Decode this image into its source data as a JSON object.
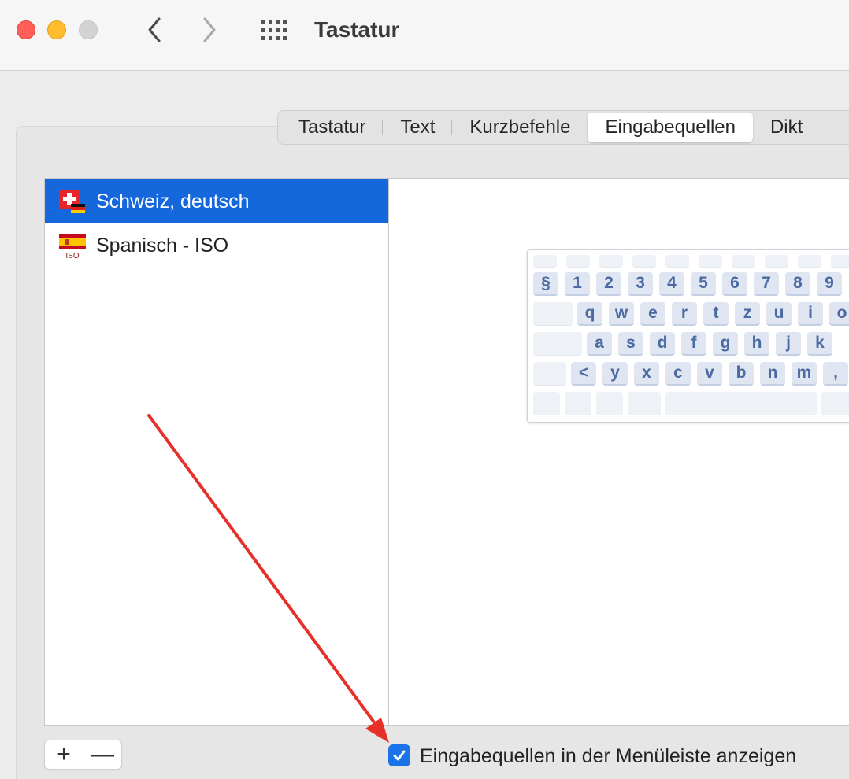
{
  "window": {
    "title": "Tastatur"
  },
  "tabs": [
    {
      "label": "Tastatur",
      "active": false
    },
    {
      "label": "Text",
      "active": false
    },
    {
      "label": "Kurzbefehle",
      "active": false
    },
    {
      "label": "Eingabequellen",
      "active": true
    },
    {
      "label": "Dikt",
      "active": false
    }
  ],
  "sources": [
    {
      "label": "Schweiz, deutsch",
      "flag": "swiss-german-flag",
      "selected": true
    },
    {
      "label": "Spanisch - ISO",
      "flag": "spanish-iso-flag",
      "flag_text": "ISO",
      "selected": false
    }
  ],
  "keyboard": {
    "rows": [
      [
        "§",
        "1",
        "2",
        "3",
        "4",
        "5",
        "6",
        "7",
        "8",
        "9"
      ],
      [
        "q",
        "w",
        "e",
        "r",
        "t",
        "z",
        "u",
        "i",
        "o"
      ],
      [
        "a",
        "s",
        "d",
        "f",
        "g",
        "h",
        "j",
        "k"
      ],
      [
        "<",
        "y",
        "x",
        "c",
        "v",
        "b",
        "n",
        "m",
        ","
      ]
    ]
  },
  "controls": {
    "add_label": "+",
    "remove_label": "—",
    "show_in_menubar_label": "Eingabequellen in der Menüleiste anzeigen",
    "show_in_menubar_checked": true
  },
  "colors": {
    "selection": "#1468dc",
    "checkbox": "#1a73e8",
    "annotation_arrow": "#e8302a",
    "key_text": "#4a6aa3"
  }
}
